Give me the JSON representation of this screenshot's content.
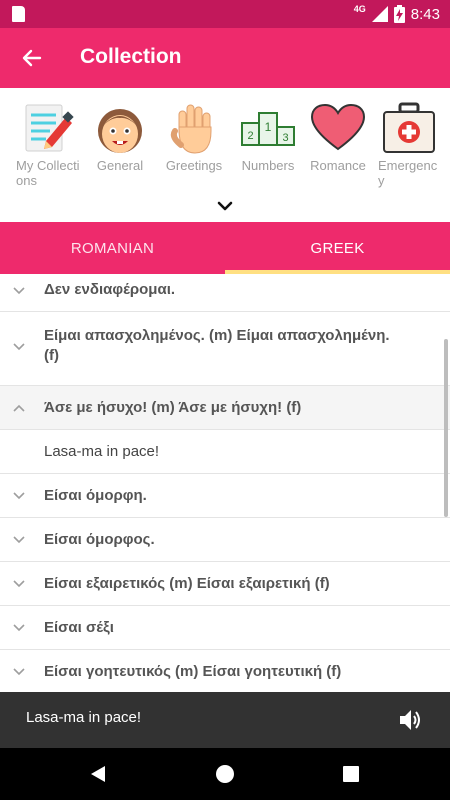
{
  "status_bar": {
    "network": "4G",
    "time": "8:43"
  },
  "app_bar": {
    "title": "Collection"
  },
  "categories": [
    {
      "label": "My Collections",
      "icon": "notepad-pencil-icon"
    },
    {
      "label": "General",
      "icon": "smiling-face-icon"
    },
    {
      "label": "Greetings",
      "icon": "waving-hand-icon"
    },
    {
      "label": "Numbers",
      "icon": "podium-icon"
    },
    {
      "label": "Romance",
      "icon": "heart-icon"
    },
    {
      "label": "Emergency",
      "icon": "first-aid-kit-icon"
    }
  ],
  "tabs": {
    "romanian": "ROMANIAN",
    "greek": "GREEK",
    "selected": "GREEK"
  },
  "phrases": [
    {
      "text": "Δεν ενδιαφέρομαι."
    },
    {
      "text": "Είμαι απασχολημένος. (m)  Είμαι απασχολημένη. (f)"
    },
    {
      "text": "Άσε με ήσυχο! (m)  Άσε με ήσυχη! (f)",
      "expanded": true
    },
    {
      "text": "Lasa-ma in pace!",
      "answer": true
    },
    {
      "text": "Είσαι όμορφη."
    },
    {
      "text": "Είσαι όμορφος."
    },
    {
      "text": "Είσαι εξαιρετικός (m)  Είσαι εξαιρετική (f)"
    },
    {
      "text": "Είσαι σέξι"
    },
    {
      "text": "Είσαι γοητευτικός (m)  Είσαι γοητευτική (f)"
    }
  ],
  "player": {
    "now_playing": "Lasa-ma in pace!"
  },
  "colors": {
    "status_bar": "#c2185b",
    "accent": "#ee2a6c",
    "tab_indicator": "#ffe082",
    "player_bg": "#323232"
  }
}
